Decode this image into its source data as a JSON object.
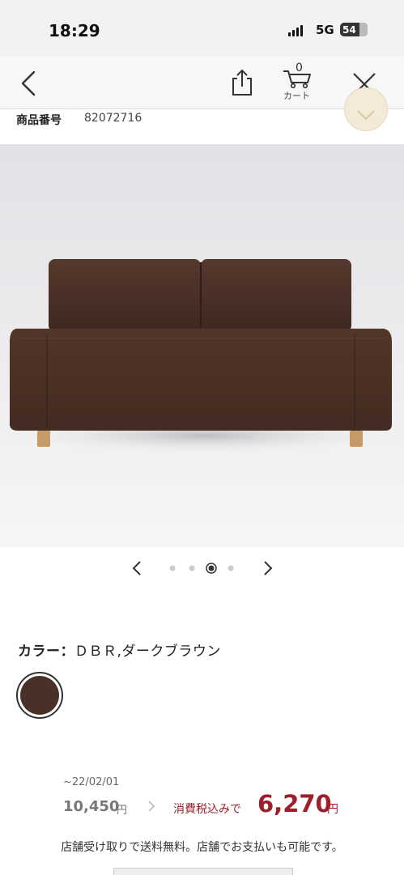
{
  "status_bar": {
    "time": "18:29",
    "network": "5G",
    "battery": "54"
  },
  "nav": {
    "back_icon": "chevron-left-icon",
    "share_icon": "share-icon",
    "cart_icon": "cart-icon",
    "cart_count": "0",
    "cart_label": "カート",
    "close_icon": "close-icon"
  },
  "product": {
    "number_label": "商品番号",
    "number_value": "82072716"
  },
  "gallery": {
    "current_index": 3,
    "total": 4,
    "prev_icon": "chevron-left-icon",
    "next_icon": "chevron-right-icon"
  },
  "color": {
    "label": "カラー：",
    "value": "ＤＢＲ,ダークブラウン",
    "swatch_color": "#4a3128"
  },
  "price": {
    "date": "~22/02/01",
    "old_price": "10,450",
    "old_yen": "円",
    "tax_label": "消費税込みで",
    "new_price": "6,270",
    "new_yen": "円",
    "accent_color": "#9c1f2b"
  },
  "note": "店舗受け取りで送料無料。店舗でお支払いも可能です。"
}
